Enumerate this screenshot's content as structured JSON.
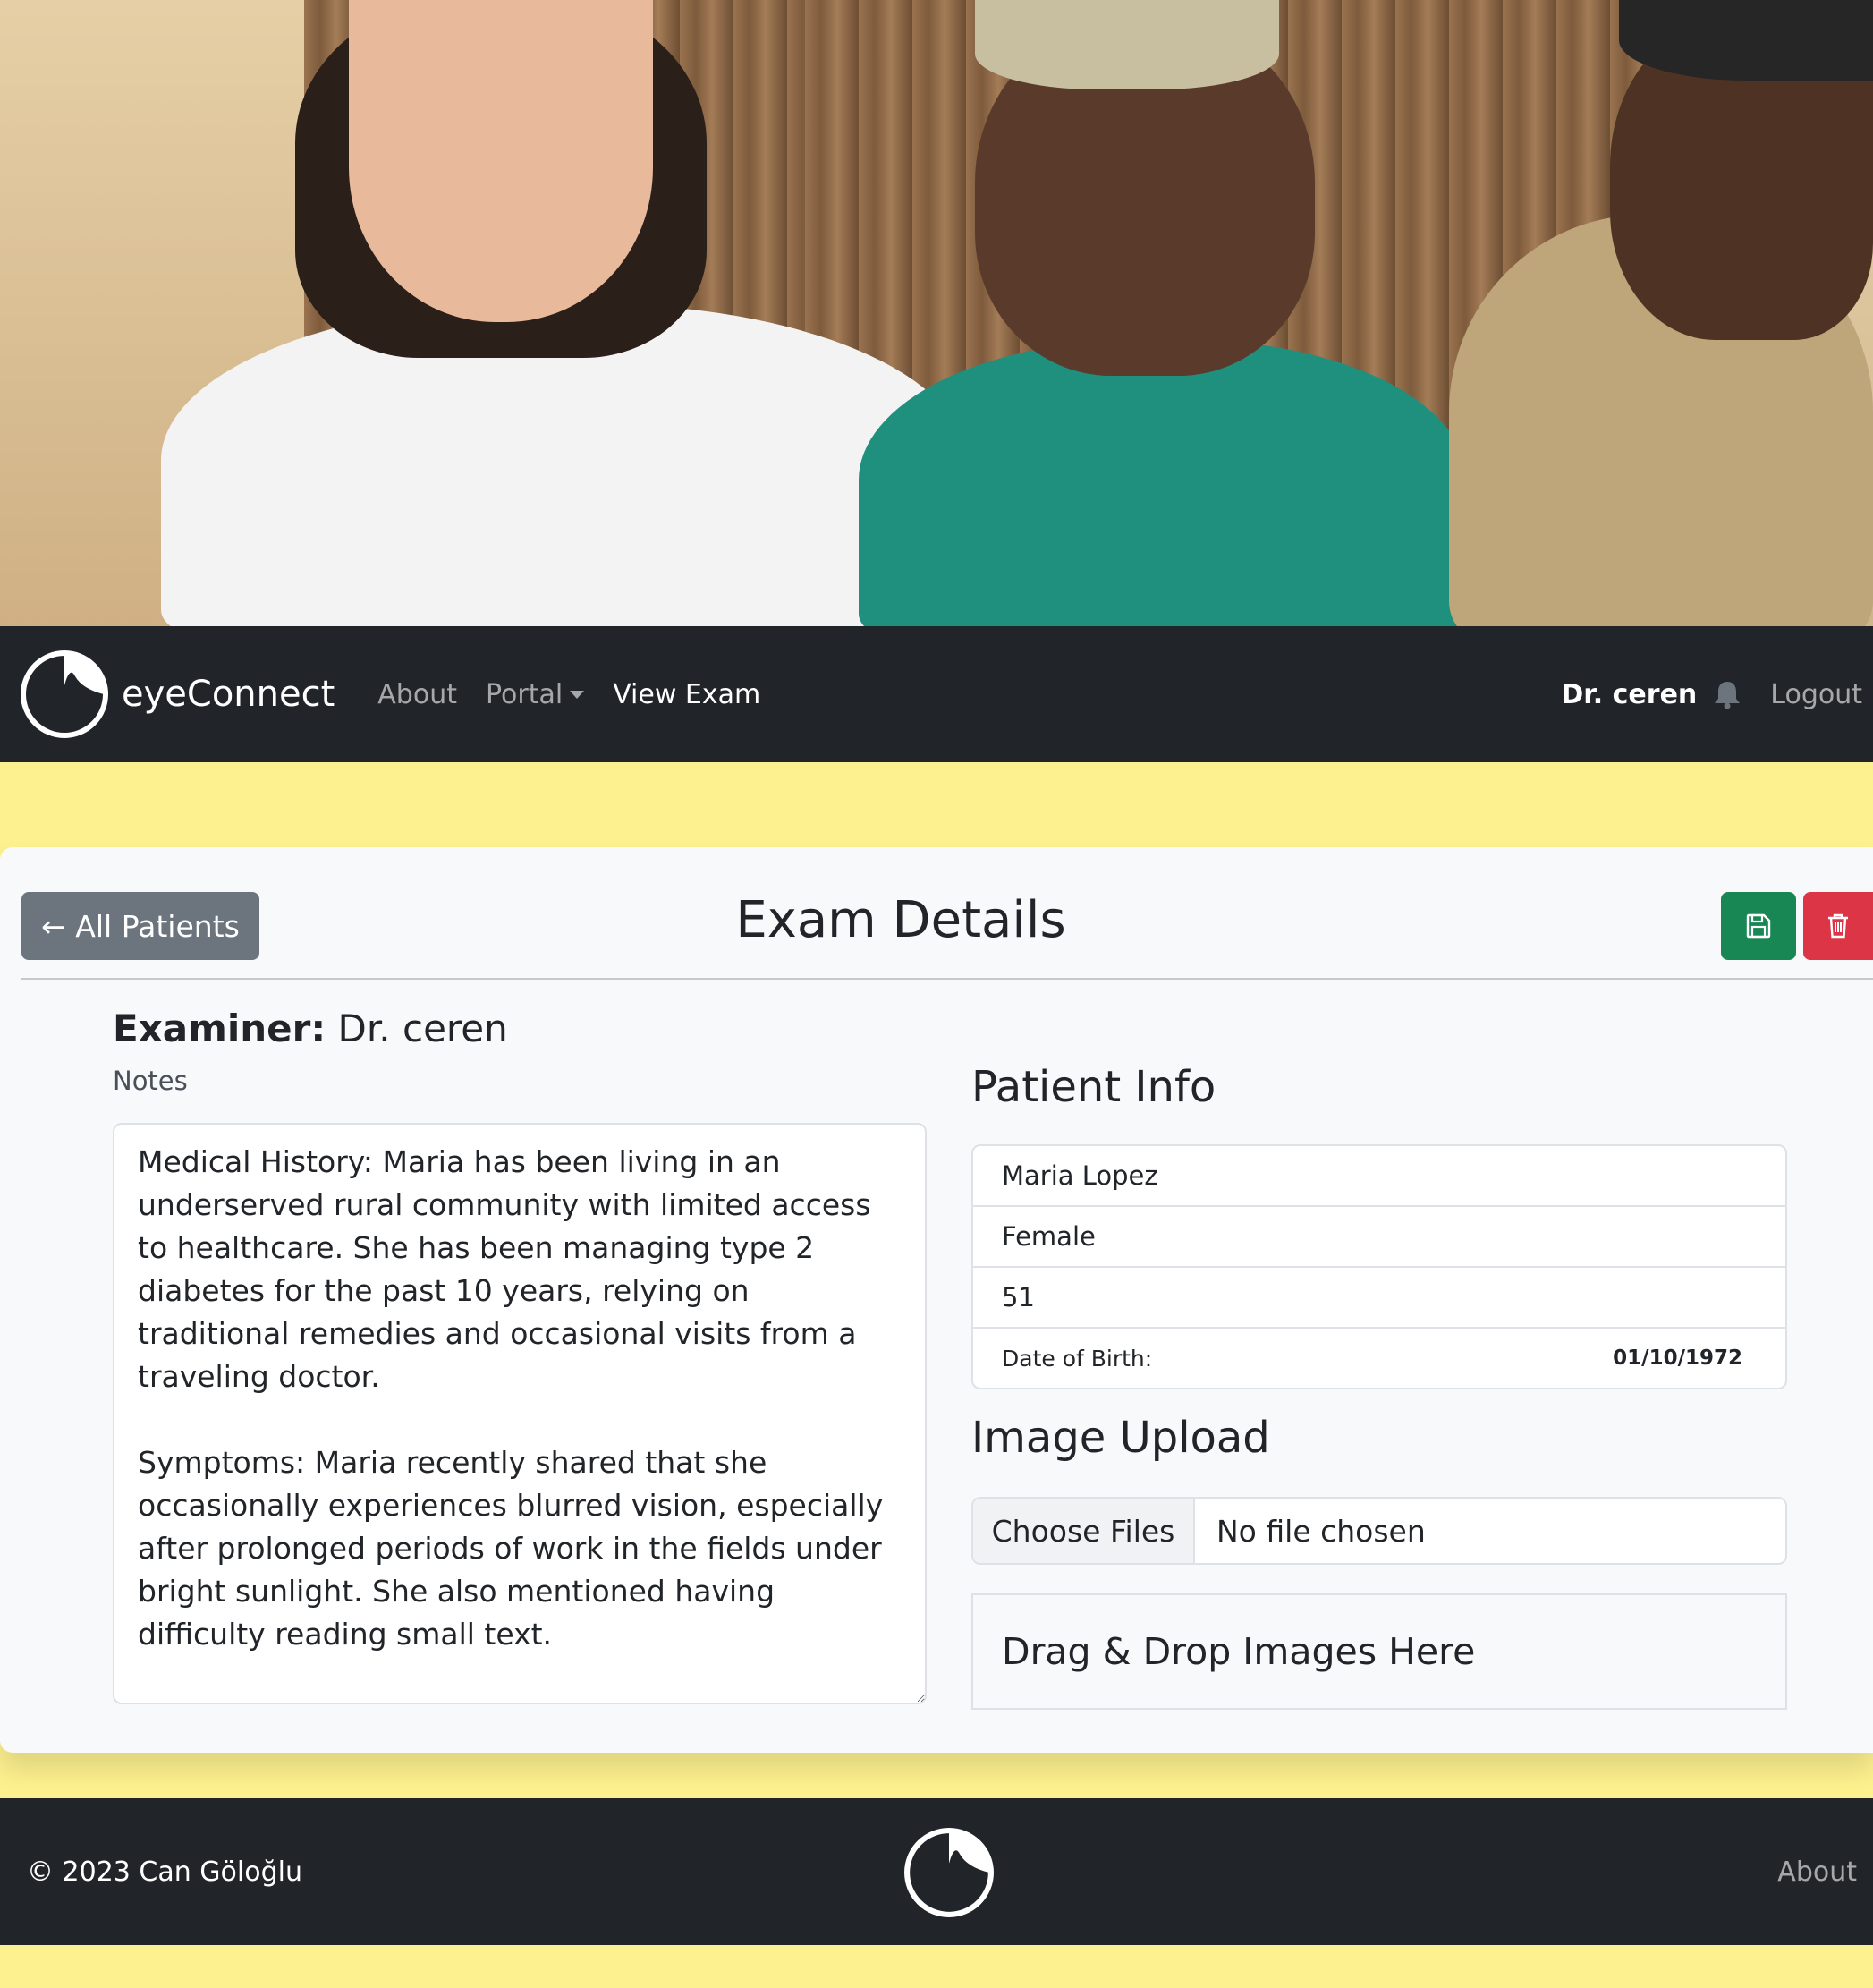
{
  "hero": {
    "image": "clinic-hero-photo"
  },
  "navbar": {
    "brand": "eyeConnect",
    "links": [
      {
        "label": "About"
      },
      {
        "label": "Portal"
      },
      {
        "label": "View Exam"
      }
    ],
    "user": "Dr. ceren",
    "logout": "Logout",
    "icons": {
      "logo": "eye-logo-icon",
      "notification": "bell-icon"
    }
  },
  "exam": {
    "back_button": "← All Patients",
    "title": "Exam Details",
    "save_icon": "save-icon",
    "delete_icon": "trash-icon",
    "examiner_label": "Examiner:",
    "examiner_name": "Dr. ceren",
    "notes_label": "Notes",
    "notes_text": "Medical History: Maria has been living in an underserved rural community with limited access to healthcare. She has been managing type 2 diabetes for the past 10 years, relying on traditional remedies and occasional visits from a traveling doctor.\n\nSymptoms: Maria recently shared that she occasionally experiences blurred vision, especially after prolonged periods of work in the fields under bright sunlight. She also mentioned having difficulty reading small text.\n\nRisk Factors: Living in a remote area, Maria has limited access to regular medical check-ups. Her diabetes"
  },
  "patient_info": {
    "heading": "Patient Info",
    "name": "Maria Lopez",
    "gender": "Female",
    "age": "51",
    "dob_label": "Date of Birth:",
    "dob_value": "01/10/1972"
  },
  "image_upload": {
    "heading": "Image Upload",
    "choose_button": "Choose Files",
    "status": "No file chosen",
    "dropzone_text": "Drag & Drop Images Here"
  },
  "footer": {
    "copyright": "© 2023 Can Göloğlu",
    "about": "About"
  },
  "colors": {
    "page_bg": "#fdf08e",
    "navbar_bg": "#212529",
    "card_bg": "#f8f9fa",
    "secondary": "#6c757d",
    "success": "#198754",
    "danger": "#dc3545"
  }
}
